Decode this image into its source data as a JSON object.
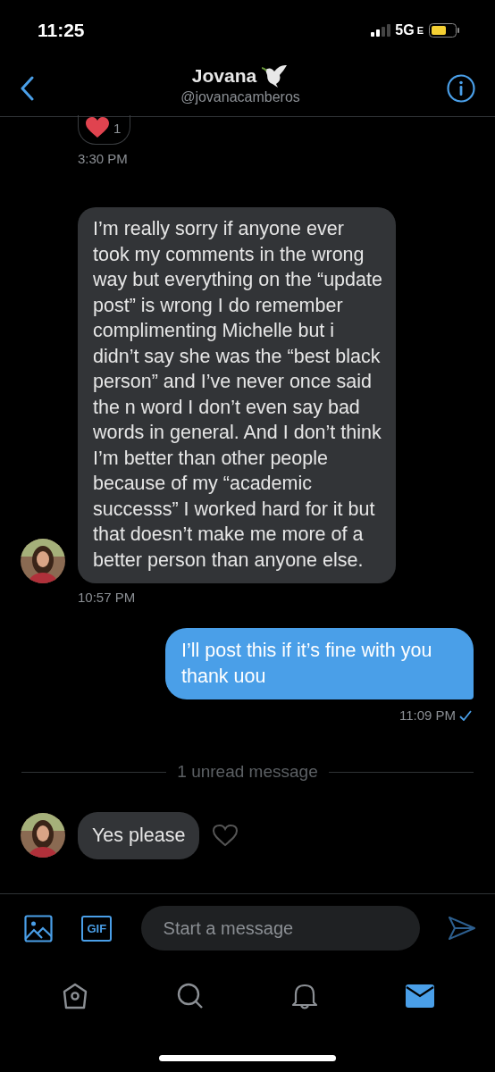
{
  "status_bar": {
    "time": "11:25",
    "network": "5G",
    "network_suffix": "E"
  },
  "header": {
    "name": "Jovana",
    "handle": "@jovanacamberos"
  },
  "messages": [
    {
      "kind": "reaction",
      "count": "1",
      "time": "3:30 PM"
    },
    {
      "kind": "received",
      "text": "I’m really sorry if anyone ever took my comments in the wrong way but everything on the “update post” is wrong I do remember complimenting Michelle but i didn’t say she was the “best black person” and I’ve never once said the n word I don’t even say bad words in general. And I don’t think I’m better than other people because of my “academic successs” I worked hard for it but that doesn’t make me more of a better person than anyone else.",
      "time": "10:57 PM"
    },
    {
      "kind": "sent",
      "text": "I’ll post this if it’s fine with you thank uou",
      "time": "11:09 PM"
    },
    {
      "kind": "divider",
      "text": "1 unread message"
    },
    {
      "kind": "received_short",
      "text": "Yes please"
    }
  ],
  "composer": {
    "placeholder": "Start a message",
    "gif": "GIF"
  },
  "tab_bar": [
    {
      "kind": "home",
      "selected": false
    },
    {
      "kind": "search",
      "selected": false
    },
    {
      "kind": "bell",
      "selected": false
    },
    {
      "kind": "mail",
      "selected": true
    }
  ]
}
